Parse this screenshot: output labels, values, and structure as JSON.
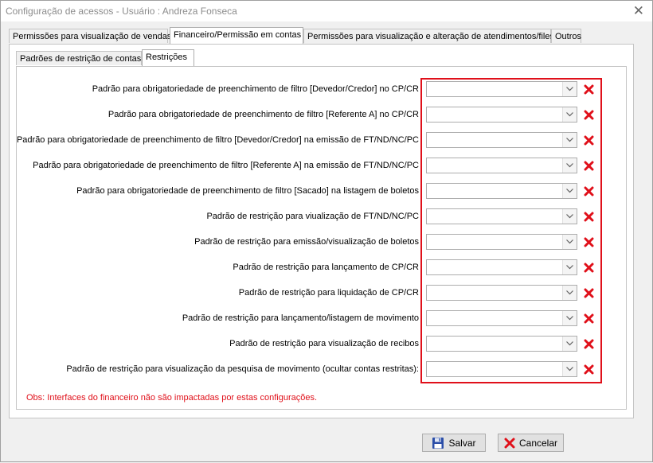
{
  "window": {
    "title": "Configuração de acessos - Usuário : Andreza Fonseca"
  },
  "outer_tabs": [
    {
      "label": "Permissões para visualização de vendas",
      "active": false
    },
    {
      "label": "Financeiro/Permissão em contas",
      "active": true
    },
    {
      "label": "Permissões para visualização e alteração de atendimentos/files",
      "active": false
    },
    {
      "label": "Outros",
      "active": false
    }
  ],
  "inner_tabs": [
    {
      "label": "Padrões de restrição de contas",
      "active": false
    },
    {
      "label": "Restrições",
      "active": true
    }
  ],
  "rows": [
    {
      "label": "Padrão para obrigatoriedade de preenchimento de filtro [Devedor/Credor] no CP/CR",
      "value": ""
    },
    {
      "label": "Padrão para obrigatoriedade de preenchimento de filtro [Referente A] no CP/CR",
      "value": ""
    },
    {
      "label": "Padrão para obrigatoriedade de preenchimento de filtro [Devedor/Credor] na emissão de FT/ND/NC/PC",
      "value": ""
    },
    {
      "label": "Padrão para obrigatoriedade de preenchimento de filtro [Referente A] na emissão de FT/ND/NC/PC",
      "value": ""
    },
    {
      "label": "Padrão para obrigatoriedade de preenchimento de filtro [Sacado] na listagem de boletos",
      "value": ""
    },
    {
      "label": "Padrão de restrição para viualização de FT/ND/NC/PC",
      "value": ""
    },
    {
      "label": "Padrão de restrição para emissão/visualização de boletos",
      "value": ""
    },
    {
      "label": "Padrão de restrição para lançamento de CP/CR",
      "value": ""
    },
    {
      "label": "Padrão de restrição para liquidação de CP/CR",
      "value": ""
    },
    {
      "label": "Padrão de restrição para lançamento/listagem de movimento",
      "value": ""
    },
    {
      "label": "Padrão de restrição para visualização de recibos",
      "value": ""
    },
    {
      "label": "Padrão de restrição para visualização da pesquisa de movimento (ocultar contas restritas):",
      "value": ""
    }
  ],
  "obs": "Obs: Interfaces do financeiro não são impactadas por estas configurações.",
  "buttons": {
    "save_label": "Salvar",
    "cancel_label": "Cancelar"
  },
  "colors": {
    "highlight": "#e0101a",
    "delete_icon": "#e0101a",
    "obs_text": "#e0101a"
  }
}
